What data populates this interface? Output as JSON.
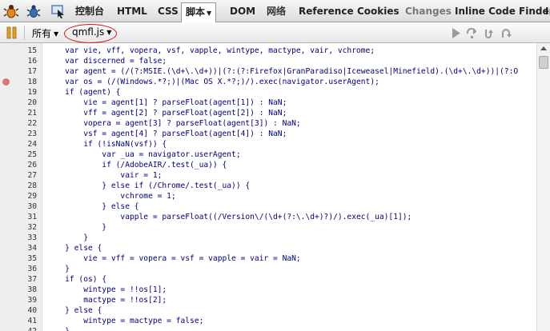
{
  "tabs": {
    "console": "控制台",
    "html": "HTML",
    "css": "CSS",
    "script": "脚本",
    "dom": "DOM",
    "net": "网络",
    "reference": "Reference",
    "cookies": "Cookies",
    "changes": "Changes",
    "inline_code_finder": "Inline Code Finder",
    "overflow": "I"
  },
  "toolbar": {
    "filter": "所有",
    "file": "qmfl.js"
  },
  "icons": {
    "firebug": "firebug-icon",
    "bug": "bug-icon",
    "inspect": "inspect-icon",
    "pause": "pause-icon",
    "continue": "continue-icon",
    "step_over": "step-over-icon",
    "step_into": "step-into-icon",
    "step_out": "step-out-icon"
  },
  "colors": {
    "code_text": "#00007f",
    "code_string": "#007f00",
    "breakpoint": "#d77777",
    "highlight_ring": "#dd1111"
  },
  "code": [
    {
      "n": "15",
      "t": "    var vie, vff, vopera, vsf, vapple, wintype, mactype, vair, vchrome;"
    },
    {
      "n": "16",
      "t": "    var discerned = false;"
    },
    {
      "n": "17",
      "t": "    var agent = (/(?:MSIE.(\\d+\\.\\d+))|(?:(?:Firefox|GranParadiso|Iceweasel|Minefield).(\\d+\\.\\d+))|(?:O"
    },
    {
      "n": "18",
      "t": "    var os = (/(Windows.*?;)|(Mac OS X.*?;)/).exec(navigator.userAgent);",
      "bp": true
    },
    {
      "n": "19",
      "t": "    if (agent) {"
    },
    {
      "n": "20",
      "t": "        vie = agent[1] ? parseFloat(agent[1]) : NaN;"
    },
    {
      "n": "21",
      "t": "        vff = agent[2] ? parseFloat(agent[2]) : NaN;"
    },
    {
      "n": "22",
      "t": "        vopera = agent[3] ? parseFloat(agent[3]) : NaN;"
    },
    {
      "n": "23",
      "t": "        vsf = agent[4] ? parseFloat(agent[4]) : NaN;"
    },
    {
      "n": "24",
      "t": "        if (!isNaN(vsf)) {"
    },
    {
      "n": "25",
      "t": "            var _ua = navigator.userAgent;"
    },
    {
      "n": "26",
      "t": "            if (/AdobeAIR/.test(_ua)) {"
    },
    {
      "n": "27",
      "t": "                vair = 1;"
    },
    {
      "n": "28",
      "t": "            } else if (/Chrome/.test(_ua)) {"
    },
    {
      "n": "29",
      "t": "                vchrome = 1;"
    },
    {
      "n": "30",
      "t": "            } else {"
    },
    {
      "n": "31",
      "t": "                vapple = parseFloat((/Version\\/(\\d+(?:\\.\\d+)?)/).exec(_ua)[1]);"
    },
    {
      "n": "32",
      "t": "            }"
    },
    {
      "n": "33",
      "t": "        }"
    },
    {
      "n": "34",
      "t": "    } else {"
    },
    {
      "n": "35",
      "t": "        vie = vff = vopera = vsf = vapple = vair = NaN;"
    },
    {
      "n": "36",
      "t": "    }"
    },
    {
      "n": "37",
      "t": "    if (os) {"
    },
    {
      "n": "38",
      "t": "        wintype = !!os[1];"
    },
    {
      "n": "39",
      "t": "        mactype = !!os[2];"
    },
    {
      "n": "40",
      "t": "    } else {"
    },
    {
      "n": "41",
      "t": "        wintype = mactype = false;"
    },
    {
      "n": "42",
      "t": "    }"
    }
  ]
}
